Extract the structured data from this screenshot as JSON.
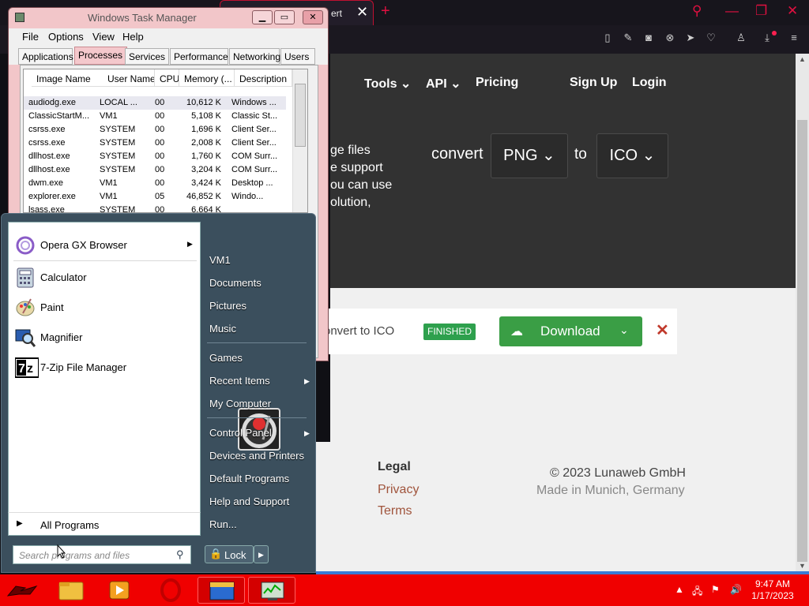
{
  "browser": {
    "tab_title": "ert",
    "site_nav": [
      "Tools",
      "API",
      "Pricing",
      "Sign Up",
      "Login"
    ],
    "hero_lines": [
      "ge files",
      "e support",
      "ou can use",
      "olution,"
    ],
    "convert_label": "convert",
    "from_format": "PNG",
    "to_label": "to",
    "to_format": "ICO",
    "job_label": "onvert to ICO",
    "job_status": "FINISHED",
    "download_label": "Download",
    "footer_heading": "Legal",
    "footer_links": [
      "Privacy",
      "Terms"
    ],
    "copyright": "© 2023 Lunaweb GmbH",
    "made_in": "Made in Munich, Germany",
    "accent_color": "#e01040"
  },
  "taskmgr": {
    "title": "Windows Task Manager",
    "menus": [
      "File",
      "Options",
      "View",
      "Help"
    ],
    "tabs": [
      "Applications",
      "Processes",
      "Services",
      "Performance",
      "Networking",
      "Users"
    ],
    "active_tab": "Processes",
    "columns": [
      "Image Name",
      "User Name",
      "CPU",
      "Memory (...",
      "Description"
    ],
    "rows": [
      [
        "audiodg.exe",
        "LOCAL ...",
        "00",
        "10,612 K",
        "Windows ..."
      ],
      [
        "ClassicStartM...",
        "VM1",
        "00",
        "5,108 K",
        "Classic St..."
      ],
      [
        "csrss.exe",
        "SYSTEM",
        "00",
        "1,696 K",
        "Client Ser..."
      ],
      [
        "csrss.exe",
        "SYSTEM",
        "00",
        "2,008 K",
        "Client Ser..."
      ],
      [
        "dllhost.exe",
        "SYSTEM",
        "00",
        "1,760 K",
        "COM Surr..."
      ],
      [
        "dllhost.exe",
        "SYSTEM",
        "00",
        "3,204 K",
        "COM Surr..."
      ],
      [
        "dwm.exe",
        "VM1",
        "00",
        "3,424 K",
        "Desktop ..."
      ],
      [
        "explorer.exe",
        "VM1",
        "05",
        "46,852 K",
        "Windo..."
      ],
      [
        "lsass.exe",
        "SYSTEM",
        "00",
        "6,664 K",
        ""
      ]
    ]
  },
  "startmenu": {
    "pinned": [
      {
        "label": "Opera GX Browser",
        "icon": "opera-gx-icon",
        "has_submenu": true
      },
      {
        "label": "Calculator",
        "icon": "calculator-icon"
      },
      {
        "label": "Paint",
        "icon": "paint-icon"
      },
      {
        "label": "Magnifier",
        "icon": "magnifier-icon"
      },
      {
        "label": "7-Zip File Manager",
        "icon": "7zip-icon"
      }
    ],
    "all_programs": "All Programs",
    "search_placeholder": "Search programs and files",
    "right_items": [
      "VM1",
      "Documents",
      "Pictures",
      "Music",
      "Games",
      "Recent Items",
      "My Computer",
      "Control Panel",
      "Devices and Printers",
      "Default Programs",
      "Help and Support",
      "Run..."
    ],
    "lock_label": "Lock"
  },
  "taskbar": {
    "time": "9:47 AM",
    "date": "1/17/2023",
    "bar_color": "#f00000"
  }
}
